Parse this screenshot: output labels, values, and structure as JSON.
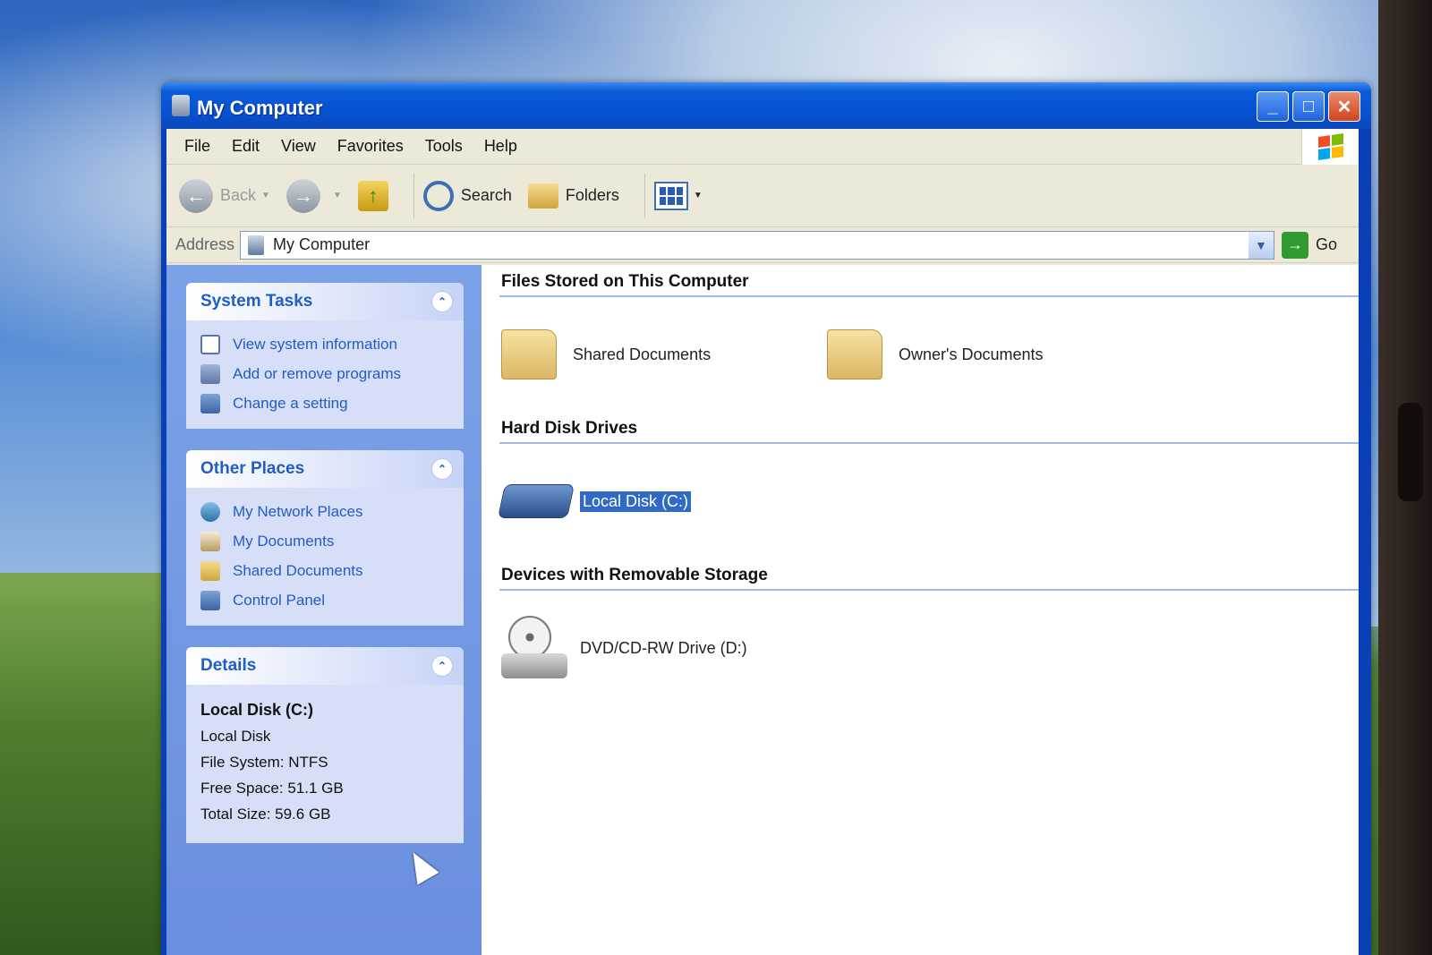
{
  "window": {
    "title": "My Computer"
  },
  "menu": [
    "File",
    "Edit",
    "View",
    "Favorites",
    "Tools",
    "Help"
  ],
  "toolbar": {
    "back_label": "Back",
    "search_label": "Search",
    "folders_label": "Folders"
  },
  "address": {
    "label": "Address",
    "value": "My Computer",
    "go_label": "Go"
  },
  "system_tasks": {
    "title": "System Tasks",
    "items": [
      "View system information",
      "Add or remove programs",
      "Change a setting"
    ]
  },
  "other_places": {
    "title": "Other Places",
    "items": [
      "My Network Places",
      "My Documents",
      "Shared Documents",
      "Control Panel"
    ]
  },
  "details": {
    "title": "Details",
    "name": "Local Disk (C:)",
    "type": "Local Disk",
    "file_system": "File System: NTFS",
    "free_space": "Free Space: 51.1 GB",
    "total_size": "Total Size: 59.6 GB"
  },
  "groups": {
    "files": {
      "title": "Files Stored on This Computer",
      "items": [
        "Shared Documents",
        "Owner's Documents"
      ]
    },
    "hdd": {
      "title": "Hard Disk Drives",
      "items": [
        "Local Disk (C:)"
      ]
    },
    "removable": {
      "title": "Devices with Removable Storage",
      "items": [
        "DVD/CD-RW Drive (D:)"
      ]
    }
  },
  "icons": {
    "folder": "folder-icon",
    "disk": "hard-disk-icon",
    "dvd": "dvd-drive-icon",
    "back": "back-arrow-icon",
    "forward": "forward-arrow-icon",
    "up": "up-folder-icon",
    "search": "search-icon",
    "folders": "folders-icon",
    "views": "views-icon"
  },
  "colors": {
    "titlebar": "#0a5bd8",
    "taskpane": "#6b8fdf",
    "link": "#215dc6",
    "selection": "#316ac5"
  }
}
